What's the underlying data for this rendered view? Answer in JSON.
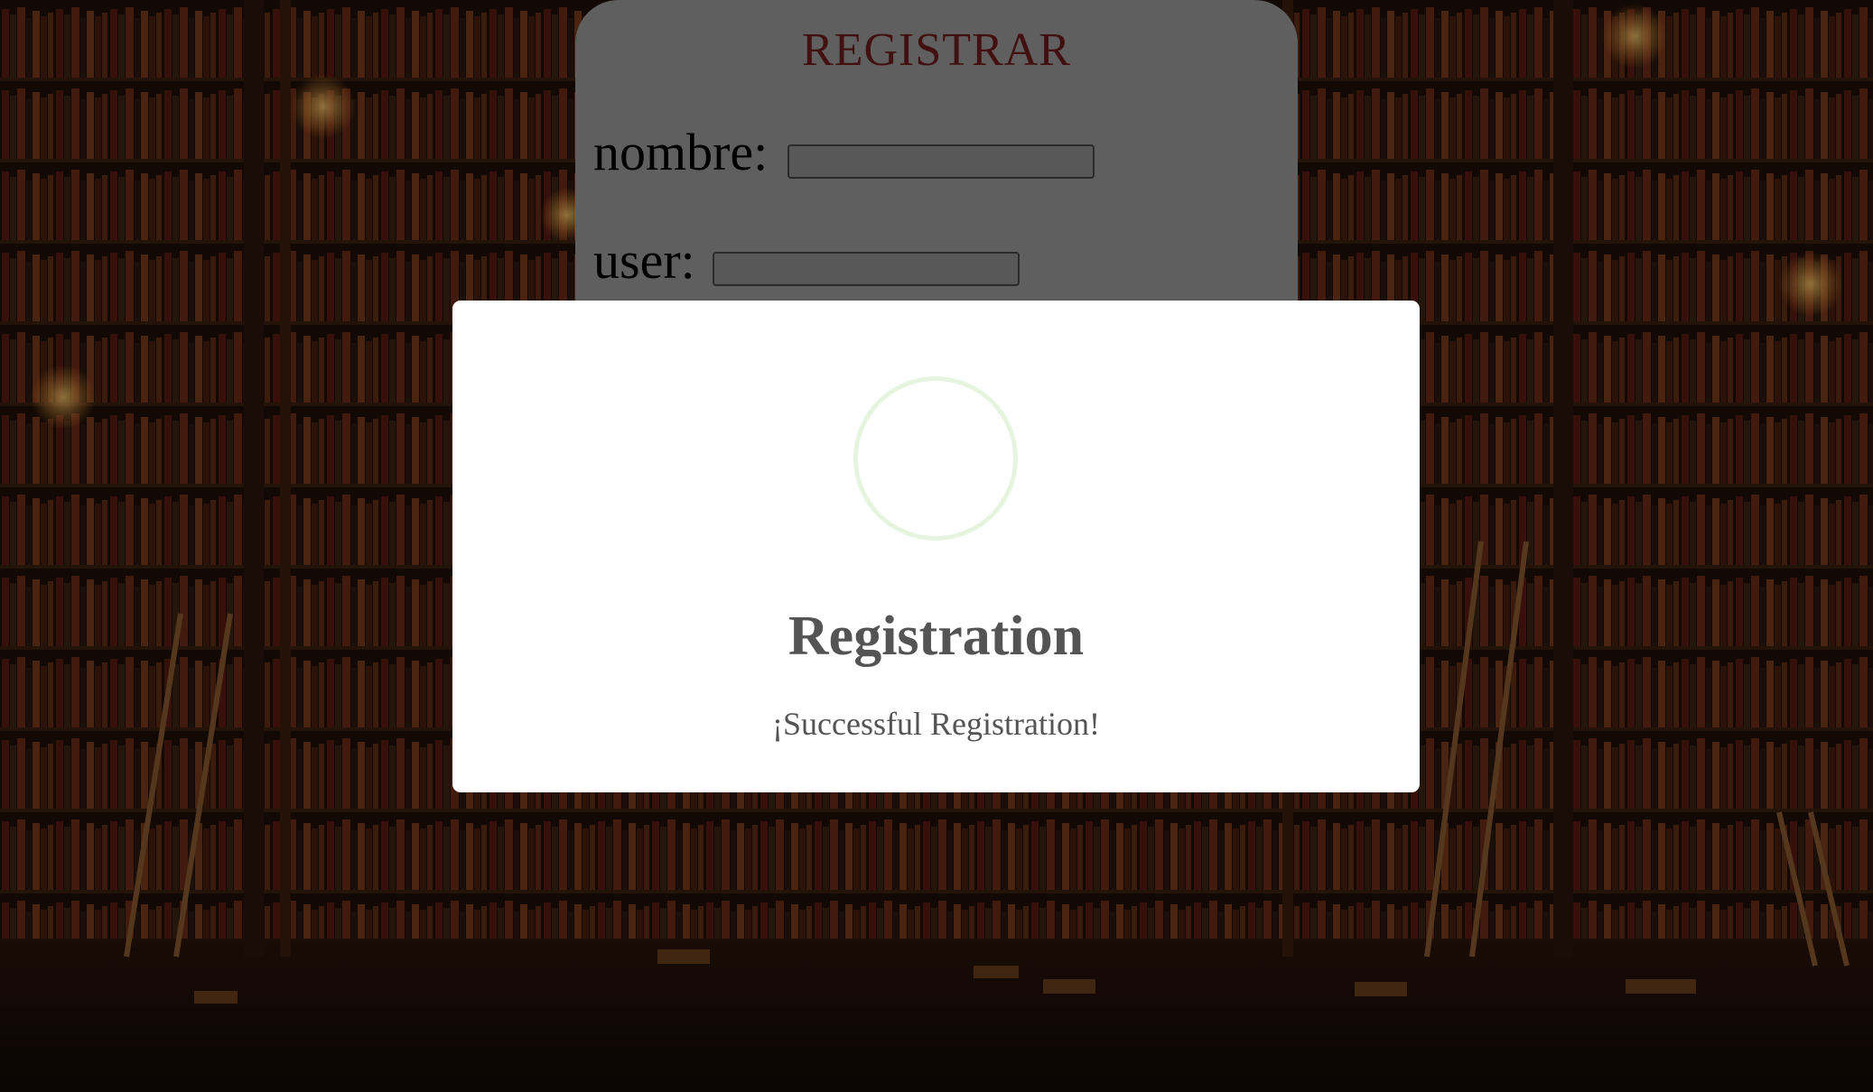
{
  "register_form": {
    "title": "REGISTRAR",
    "fields": [
      {
        "label": "nombre:",
        "value": ""
      },
      {
        "label": "user:",
        "value": ""
      }
    ]
  },
  "modal": {
    "icon": "success-circle-icon",
    "title": "Registration",
    "message": "¡Successful Registration!"
  },
  "colors": {
    "form_title": "#6b1a1a",
    "card_bg": "#9a9a9a",
    "success_ring": "#e6f4df",
    "modal_text": "#545454"
  }
}
